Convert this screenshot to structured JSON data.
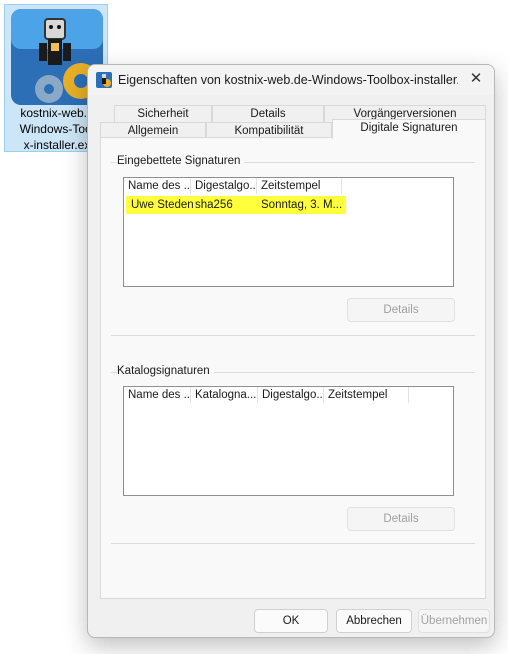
{
  "desktop_icon": {
    "label_lines": [
      "kostnix-web.d",
      "Windows-Tool",
      "x-installer.ex"
    ]
  },
  "dialog": {
    "title": "Eigenschaften von kostnix-web.de-Windows-Toolbox-installer.e...",
    "close_glyph": "✕",
    "tabs_back_row": [
      "Sicherheit",
      "Details",
      "Vorgängerversionen"
    ],
    "tabs_front_row": [
      "Allgemein",
      "Kompatibilität",
      "Digitale Signaturen"
    ],
    "active_tab": "Digitale Signaturen",
    "embedded": {
      "group_title": "Eingebettete Signaturen",
      "columns": [
        "Name des ...",
        "Digestalgo...",
        "Zeitstempel"
      ],
      "rows": [
        {
          "name": "Uwe Steden",
          "digest": "sha256",
          "timestamp": "Sonntag, 3. M...",
          "highlight": "#ffff3c"
        }
      ],
      "details_button": "Details"
    },
    "catalog": {
      "group_title": "Katalogsignaturen",
      "columns": [
        "Name des ...",
        "Katalogna...",
        "Digestalgo...",
        "Zeitstempel"
      ],
      "details_button": "Details"
    },
    "footer": {
      "ok": "OK",
      "cancel": "Abbrechen",
      "apply": "Übernehmen"
    }
  },
  "colors": {
    "highlight": "#ffff3c",
    "dialog_bg": "#f0f0f0",
    "icon_bg": "#2c6fb7"
  }
}
